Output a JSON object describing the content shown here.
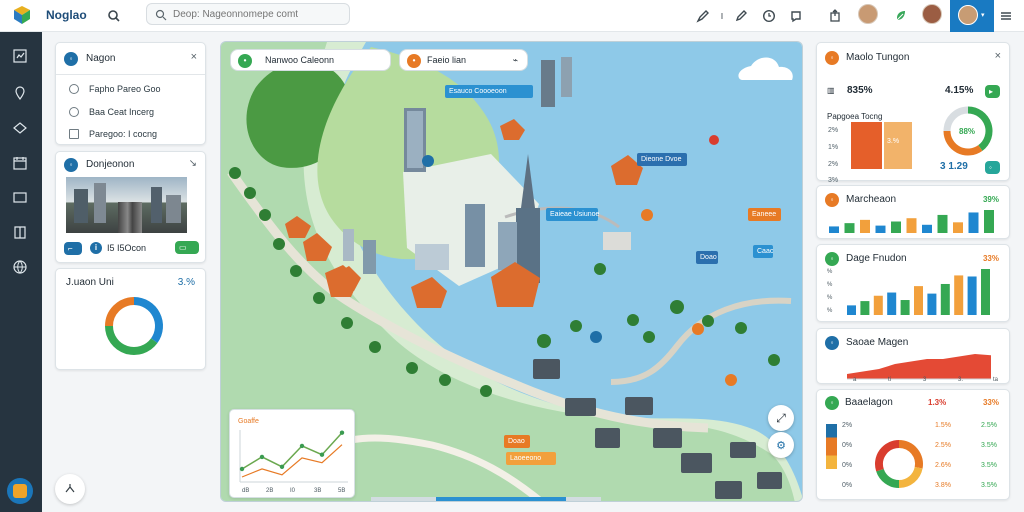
{
  "app": {
    "name": "Noglao",
    "search_placeholder": "Deop: Nageonnomepe comt"
  },
  "top": {
    "badge": "I"
  },
  "colors": {
    "blue": "#1f6fa7",
    "green": "#34a852",
    "orange": "#e77a25",
    "red": "#d93d2e",
    "dark": "#263440"
  },
  "left": {
    "card1": {
      "title": "Nagon",
      "items": [
        "Fapho Pareo Goo",
        "Baa Ceat Incerg",
        "Paregoo: I cocng"
      ]
    },
    "card2": {
      "title": "Donjeonon",
      "stat": "I5 I5Ocon"
    },
    "card3": {
      "title": "J.uaon Uni",
      "value": "3.%",
      "donut": [
        35,
        40,
        25
      ]
    }
  },
  "map": {
    "search_chip": "Nanwoo Caleonn",
    "filter_chip": "Faeio lian",
    "labels": [
      "Esauco Coooeoon",
      "Dieone Dvoe",
      "Eaieae Usiunoe",
      "Eaneee",
      "Caac",
      "Doao",
      "Doao",
      "Laoeeono"
    ],
    "mini_chart": {
      "title": "Goaffe",
      "ticks": [
        "dB",
        "2B",
        "I0",
        "3B",
        "5B"
      ],
      "values": [
        20,
        42,
        24,
        62,
        46,
        86
      ]
    }
  },
  "right": {
    "card1": {
      "title": "Maolo Tungon",
      "value": "835%",
      "badge": "4.15%",
      "label": "Papgoea Tocng",
      "rows": [
        "2%",
        "1%",
        "2%",
        "3%"
      ],
      "bar_labels": [
        "3.%",
        "%"
      ],
      "donut_value": "88%",
      "bottom_value": "3 1.29"
    },
    "card2": {
      "title": "Marcheaon",
      "value": "39%",
      "bars": [
        8,
        12,
        16,
        9,
        14,
        18,
        10,
        22,
        13,
        25,
        28
      ]
    },
    "card3": {
      "title": "Dage Fnudon",
      "value": "33%",
      "bars": [
        18,
        26,
        36,
        42,
        28,
        54,
        40,
        58,
        74,
        72,
        86
      ],
      "yticks": [
        "%",
        "%",
        "%",
        "%"
      ]
    },
    "card4": {
      "title": "Saoae Magen",
      "area": [
        4,
        6,
        8,
        12,
        14,
        16,
        16,
        18,
        20,
        19
      ],
      "xticks": [
        "a",
        "ti",
        "3",
        "3.",
        "ta"
      ]
    },
    "card5": {
      "title": "Baaelagon",
      "value": "1.3%",
      "pct": "33%",
      "rows": [
        [
          "2%",
          "1.5%",
          "2.5%"
        ],
        [
          "0%",
          "2.5%",
          "3.5%"
        ],
        [
          "0%",
          "2.6%",
          "3.5%"
        ],
        [
          "0%",
          "3.8%",
          "3.5%"
        ]
      ],
      "donut": [
        28,
        22,
        20,
        30
      ]
    }
  }
}
